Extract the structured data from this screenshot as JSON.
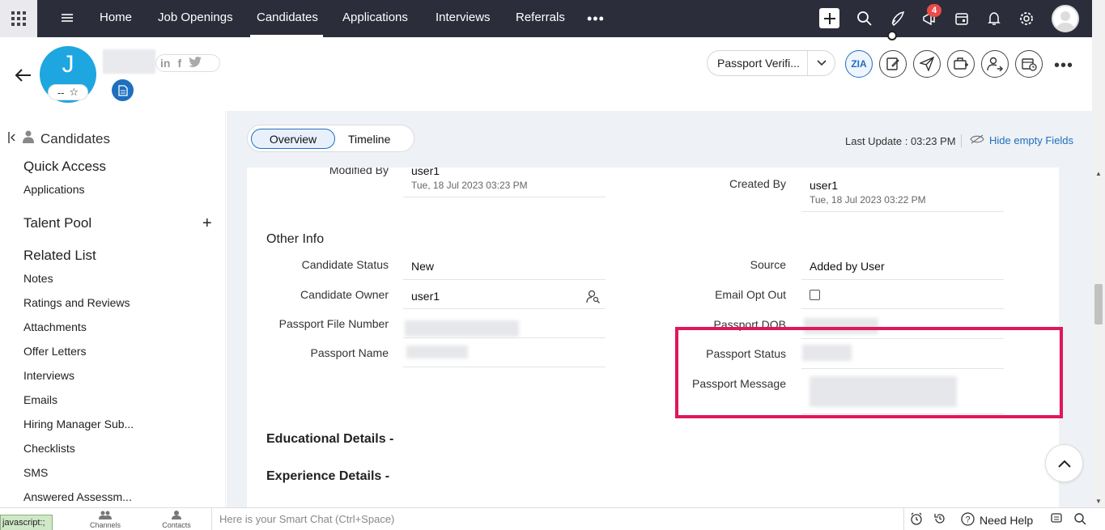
{
  "nav": {
    "items": [
      "Home",
      "Job Openings",
      "Candidates",
      "Applications",
      "Interviews",
      "Referrals"
    ],
    "active": "Candidates",
    "more": "•••",
    "notification_count": "4"
  },
  "candidate": {
    "avatar_initial": "J",
    "rating": "--",
    "status": "Passport Verifi...",
    "ai_label": "ZIA"
  },
  "sidebar": {
    "title": "Candidates",
    "quick_access": "Quick Access",
    "quick_items": [
      "Applications"
    ],
    "talent_pool": "Talent Pool",
    "related_list": "Related List",
    "related_items": [
      "Notes",
      "Ratings and Reviews",
      "Attachments",
      "Offer Letters",
      "Interviews",
      "Emails",
      "Hiring Manager Sub...",
      "Checklists",
      "SMS",
      "Answered Assessm..."
    ]
  },
  "tabs": {
    "overview": "Overview",
    "timeline": "Timeline"
  },
  "meta": {
    "last_update": "Last Update : 03:23 PM",
    "hide_empty": "Hide empty Fields"
  },
  "record": {
    "modified_by_label": "Modified By",
    "modified_by_value": "user1",
    "modified_by_time": "Tue, 18 Jul 2023 03:23 PM",
    "created_by_label": "Created By",
    "created_by_value": "user1",
    "created_by_time": "Tue, 18 Jul 2023 03:22 PM"
  },
  "other_info": {
    "title": "Other Info",
    "candidate_status_label": "Candidate Status",
    "candidate_status_value": "New",
    "candidate_owner_label": "Candidate Owner",
    "candidate_owner_value": "user1",
    "passport_file_number_label": "Passport File Number",
    "passport_name_label": "Passport Name",
    "source_label": "Source",
    "source_value": "Added by User",
    "email_opt_out_label": "Email Opt Out",
    "passport_dob_label": "Passport DOB",
    "passport_status_label": "Passport Status",
    "passport_message_label": "Passport Message"
  },
  "sections": {
    "educational": "Educational Details -",
    "experience": "Experience Details -"
  },
  "bottom": {
    "js_status": "javascript:;",
    "channels": "Channels",
    "contacts": "Contacts",
    "smart_chat_placeholder": "Here is your Smart Chat (Ctrl+Space)",
    "need_help": "Need Help"
  },
  "colors": {
    "nav_bg": "#2b2d3a",
    "accent": "#1e6fbe",
    "highlight": "#e0175b",
    "avatar": "#1ea6e0"
  }
}
